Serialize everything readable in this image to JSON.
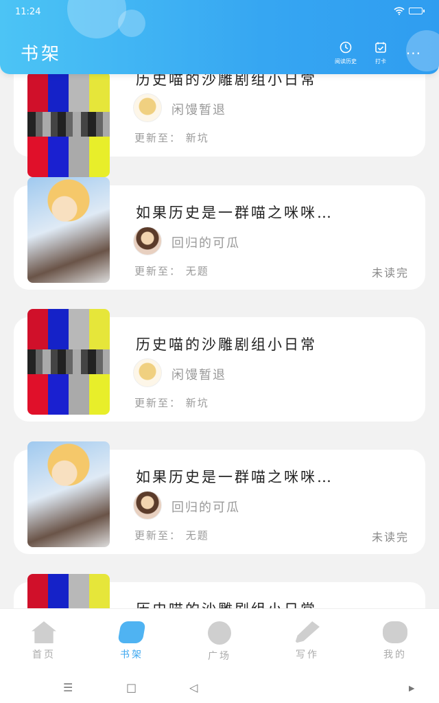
{
  "status_bar": {
    "time": "11:24",
    "wifi_icon": "wifi-icon",
    "battery_icon": "battery-icon"
  },
  "header": {
    "title": "书架",
    "history_label": "阅读历史",
    "checkin_label": "打卡",
    "more_label": "···"
  },
  "books": [
    {
      "title": "历史喵的沙雕剧组小日常",
      "author": "闲馒暂退",
      "update": "更新至： 新坑",
      "status": "",
      "cover": "bars"
    },
    {
      "title": "如果历史是一群喵之咪咪…",
      "author": "回归的可瓜",
      "update": "更新至： 无题",
      "status": "未读完",
      "cover": "anime"
    },
    {
      "title": "历史喵的沙雕剧组小日常",
      "author": "闲馒暂退",
      "update": "更新至： 新坑",
      "status": "",
      "cover": "bars"
    },
    {
      "title": "如果历史是一群喵之咪咪…",
      "author": "回归的可瓜",
      "update": "更新至： 无题",
      "status": "未读完",
      "cover": "anime"
    },
    {
      "title": "历史喵的沙雕剧组小日常",
      "author": "",
      "update": "",
      "status": "",
      "cover": "bars"
    }
  ],
  "tabs": [
    {
      "label": "首页",
      "icon": "home-icon",
      "active": false
    },
    {
      "label": "书架",
      "icon": "bookshelf-icon",
      "active": true
    },
    {
      "label": "广场",
      "icon": "plaza-icon",
      "active": false
    },
    {
      "label": "写作",
      "icon": "pen-icon",
      "active": false
    },
    {
      "label": "我的",
      "icon": "chat-icon",
      "active": false
    }
  ],
  "nav": {
    "menu": "☰",
    "home": "□",
    "back": "◁",
    "right": "▶"
  },
  "colors": {
    "accent": "#3aa6ef",
    "header_start": "#4cc4f5",
    "header_end": "#2f9df0"
  }
}
